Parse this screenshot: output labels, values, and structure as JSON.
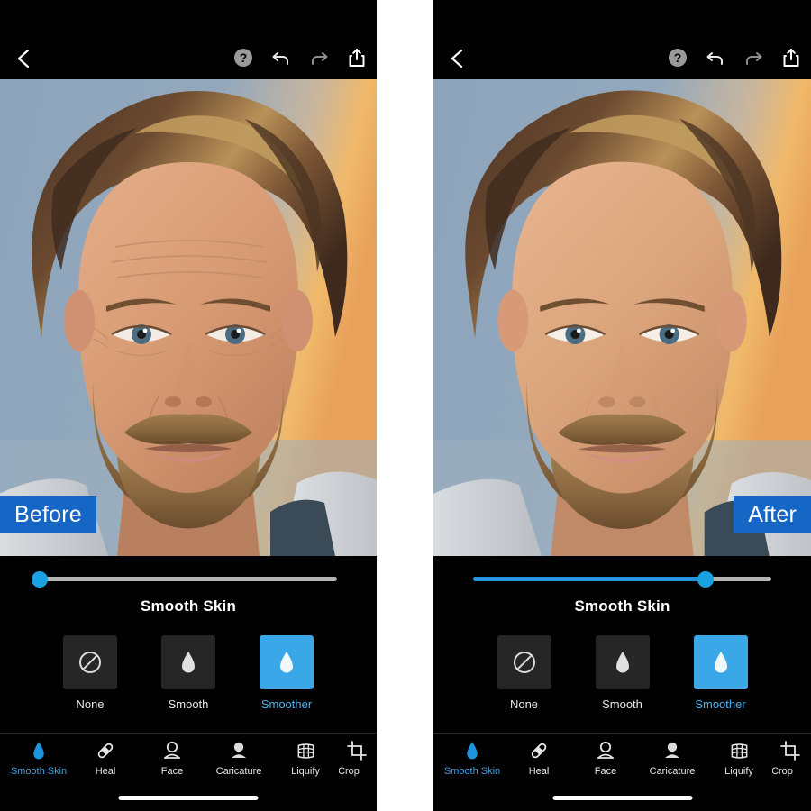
{
  "app": {
    "screen_title": "Smooth Skin",
    "background": "#ffffff"
  },
  "colors": {
    "panel_bg": "#000000",
    "accent_blue": "#1aa1e2",
    "tile_selected": "#3aa8e8",
    "badge_blue": "#1666c6",
    "tile_bg": "#262626",
    "track": "#b4b4b4"
  },
  "topbar": {
    "back_icon": "chevron-left-icon",
    "icons": [
      {
        "name": "help-icon",
        "label": "Help"
      },
      {
        "name": "undo-icon",
        "label": "Undo"
      },
      {
        "name": "redo-icon",
        "label": "Redo"
      },
      {
        "name": "share-icon",
        "label": "Share"
      }
    ]
  },
  "panels": [
    {
      "id": "before",
      "badge_label": "Before",
      "badge_position": "left",
      "slider": {
        "value": 0,
        "min": 0,
        "max": 100,
        "fill_percent": 0
      },
      "control_title": "Smooth Skin",
      "options": [
        {
          "label": "None",
          "icon": "no-smoothing-icon",
          "selected": false
        },
        {
          "label": "Smooth",
          "icon": "droplet-icon",
          "selected": false
        },
        {
          "label": "Smoother",
          "icon": "droplet-icon",
          "selected": true
        }
      ],
      "tools": [
        {
          "label": "Smooth Skin",
          "icon": "droplet-icon",
          "active": true
        },
        {
          "label": "Heal",
          "icon": "bandage-icon",
          "active": false
        },
        {
          "label": "Face",
          "icon": "face-outline-icon",
          "active": false
        },
        {
          "label": "Caricature",
          "icon": "face-filled-icon",
          "active": false
        },
        {
          "label": "Liquify",
          "icon": "grid-icon",
          "active": false
        },
        {
          "label": "Crop",
          "icon": "crop-icon",
          "active": false
        }
      ]
    },
    {
      "id": "after",
      "badge_label": "After",
      "badge_position": "right",
      "slider": {
        "value": 78,
        "min": 0,
        "max": 100,
        "fill_percent": 78
      },
      "control_title": "Smooth Skin",
      "options": [
        {
          "label": "None",
          "icon": "no-smoothing-icon",
          "selected": false
        },
        {
          "label": "Smooth",
          "icon": "droplet-icon",
          "selected": false
        },
        {
          "label": "Smoother",
          "icon": "droplet-icon",
          "selected": true
        }
      ],
      "tools": [
        {
          "label": "Smooth Skin",
          "icon": "droplet-icon",
          "active": true
        },
        {
          "label": "Heal",
          "icon": "bandage-icon",
          "active": false
        },
        {
          "label": "Face",
          "icon": "face-outline-icon",
          "active": false
        },
        {
          "label": "Caricature",
          "icon": "face-filled-icon",
          "active": false
        },
        {
          "label": "Liquify",
          "icon": "grid-icon",
          "active": false
        },
        {
          "label": "Crop",
          "icon": "crop-icon",
          "active": false
        }
      ]
    }
  ]
}
